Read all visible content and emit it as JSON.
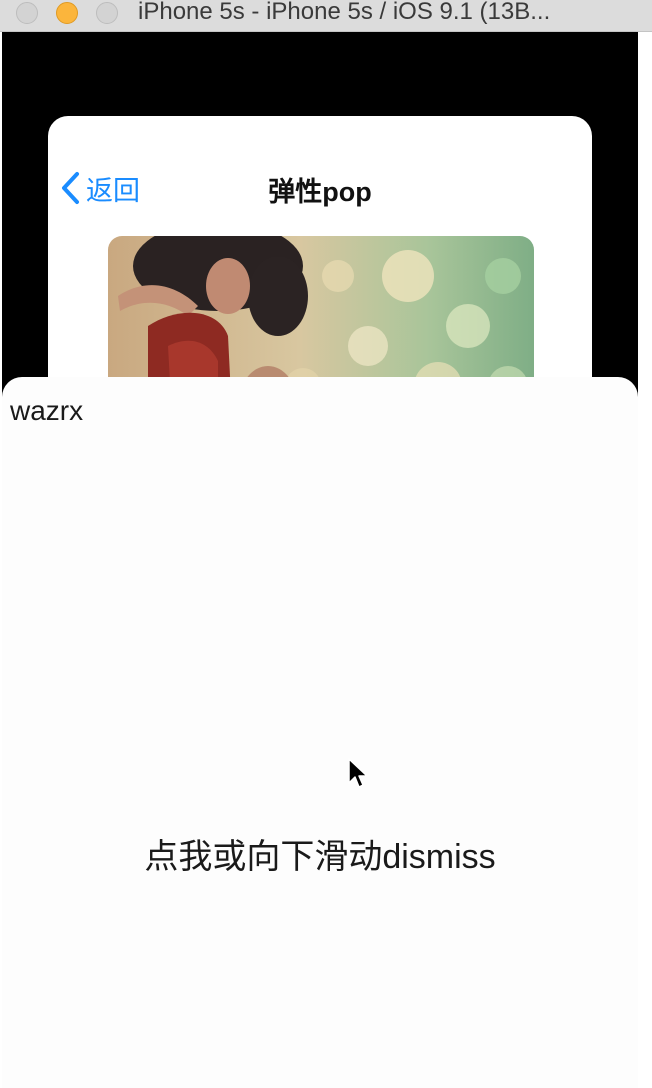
{
  "window": {
    "title": "iPhone 5s - iPhone 5s / iOS 9.1 (13B..."
  },
  "nav": {
    "back_label": "返回",
    "title": "弹性pop"
  },
  "photo": {
    "description_icon": "photo-image"
  },
  "sheet": {
    "label": "wazrx",
    "dismiss_label": "点我或向下滑动dismiss"
  },
  "colors": {
    "accent": "#1a8cff",
    "minimize": "#fbb53c"
  }
}
